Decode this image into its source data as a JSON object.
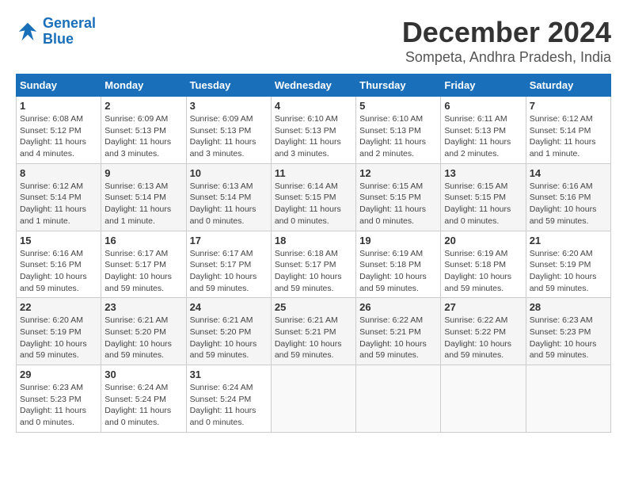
{
  "header": {
    "logo_line1": "General",
    "logo_line2": "Blue",
    "title": "December 2024",
    "subtitle": "Sompeta, Andhra Pradesh, India"
  },
  "calendar": {
    "days_of_week": [
      "Sunday",
      "Monday",
      "Tuesday",
      "Wednesday",
      "Thursday",
      "Friday",
      "Saturday"
    ],
    "weeks": [
      [
        {
          "num": "",
          "info": ""
        },
        {
          "num": "2",
          "info": "Sunrise: 6:09 AM\nSunset: 5:13 PM\nDaylight: 11 hours\nand 3 minutes."
        },
        {
          "num": "3",
          "info": "Sunrise: 6:09 AM\nSunset: 5:13 PM\nDaylight: 11 hours\nand 3 minutes."
        },
        {
          "num": "4",
          "info": "Sunrise: 6:10 AM\nSunset: 5:13 PM\nDaylight: 11 hours\nand 3 minutes."
        },
        {
          "num": "5",
          "info": "Sunrise: 6:10 AM\nSunset: 5:13 PM\nDaylight: 11 hours\nand 2 minutes."
        },
        {
          "num": "6",
          "info": "Sunrise: 6:11 AM\nSunset: 5:13 PM\nDaylight: 11 hours\nand 2 minutes."
        },
        {
          "num": "7",
          "info": "Sunrise: 6:12 AM\nSunset: 5:14 PM\nDaylight: 11 hours\nand 1 minute."
        }
      ],
      [
        {
          "num": "1",
          "info": "Sunrise: 6:08 AM\nSunset: 5:12 PM\nDaylight: 11 hours\nand 4 minutes."
        },
        {
          "num": "",
          "info": ""
        },
        {
          "num": "",
          "info": ""
        },
        {
          "num": "",
          "info": ""
        },
        {
          "num": "",
          "info": ""
        },
        {
          "num": "",
          "info": ""
        },
        {
          "num": "",
          "info": ""
        }
      ],
      [
        {
          "num": "8",
          "info": "Sunrise: 6:12 AM\nSunset: 5:14 PM\nDaylight: 11 hours\nand 1 minute."
        },
        {
          "num": "9",
          "info": "Sunrise: 6:13 AM\nSunset: 5:14 PM\nDaylight: 11 hours\nand 1 minute."
        },
        {
          "num": "10",
          "info": "Sunrise: 6:13 AM\nSunset: 5:14 PM\nDaylight: 11 hours\nand 0 minutes."
        },
        {
          "num": "11",
          "info": "Sunrise: 6:14 AM\nSunset: 5:15 PM\nDaylight: 11 hours\nand 0 minutes."
        },
        {
          "num": "12",
          "info": "Sunrise: 6:15 AM\nSunset: 5:15 PM\nDaylight: 11 hours\nand 0 minutes."
        },
        {
          "num": "13",
          "info": "Sunrise: 6:15 AM\nSunset: 5:15 PM\nDaylight: 11 hours\nand 0 minutes."
        },
        {
          "num": "14",
          "info": "Sunrise: 6:16 AM\nSunset: 5:16 PM\nDaylight: 10 hours\nand 59 minutes."
        }
      ],
      [
        {
          "num": "15",
          "info": "Sunrise: 6:16 AM\nSunset: 5:16 PM\nDaylight: 10 hours\nand 59 minutes."
        },
        {
          "num": "16",
          "info": "Sunrise: 6:17 AM\nSunset: 5:17 PM\nDaylight: 10 hours\nand 59 minutes."
        },
        {
          "num": "17",
          "info": "Sunrise: 6:17 AM\nSunset: 5:17 PM\nDaylight: 10 hours\nand 59 minutes."
        },
        {
          "num": "18",
          "info": "Sunrise: 6:18 AM\nSunset: 5:17 PM\nDaylight: 10 hours\nand 59 minutes."
        },
        {
          "num": "19",
          "info": "Sunrise: 6:19 AM\nSunset: 5:18 PM\nDaylight: 10 hours\nand 59 minutes."
        },
        {
          "num": "20",
          "info": "Sunrise: 6:19 AM\nSunset: 5:18 PM\nDaylight: 10 hours\nand 59 minutes."
        },
        {
          "num": "21",
          "info": "Sunrise: 6:20 AM\nSunset: 5:19 PM\nDaylight: 10 hours\nand 59 minutes."
        }
      ],
      [
        {
          "num": "22",
          "info": "Sunrise: 6:20 AM\nSunset: 5:19 PM\nDaylight: 10 hours\nand 59 minutes."
        },
        {
          "num": "23",
          "info": "Sunrise: 6:21 AM\nSunset: 5:20 PM\nDaylight: 10 hours\nand 59 minutes."
        },
        {
          "num": "24",
          "info": "Sunrise: 6:21 AM\nSunset: 5:20 PM\nDaylight: 10 hours\nand 59 minutes."
        },
        {
          "num": "25",
          "info": "Sunrise: 6:21 AM\nSunset: 5:21 PM\nDaylight: 10 hours\nand 59 minutes."
        },
        {
          "num": "26",
          "info": "Sunrise: 6:22 AM\nSunset: 5:21 PM\nDaylight: 10 hours\nand 59 minutes."
        },
        {
          "num": "27",
          "info": "Sunrise: 6:22 AM\nSunset: 5:22 PM\nDaylight: 10 hours\nand 59 minutes."
        },
        {
          "num": "28",
          "info": "Sunrise: 6:23 AM\nSunset: 5:23 PM\nDaylight: 10 hours\nand 59 minutes."
        }
      ],
      [
        {
          "num": "29",
          "info": "Sunrise: 6:23 AM\nSunset: 5:23 PM\nDaylight: 11 hours\nand 0 minutes."
        },
        {
          "num": "30",
          "info": "Sunrise: 6:24 AM\nSunset: 5:24 PM\nDaylight: 11 hours\nand 0 minutes."
        },
        {
          "num": "31",
          "info": "Sunrise: 6:24 AM\nSunset: 5:24 PM\nDaylight: 11 hours\nand 0 minutes."
        },
        {
          "num": "",
          "info": ""
        },
        {
          "num": "",
          "info": ""
        },
        {
          "num": "",
          "info": ""
        },
        {
          "num": "",
          "info": ""
        }
      ]
    ]
  }
}
